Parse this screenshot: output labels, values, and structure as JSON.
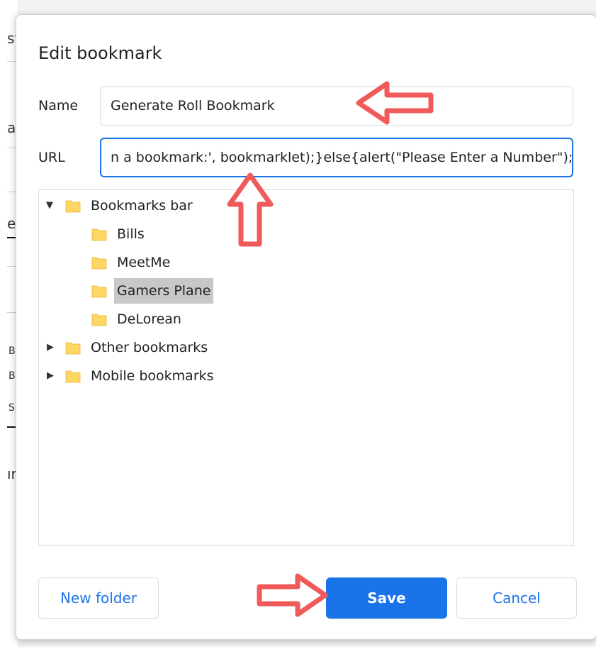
{
  "background": {
    "fragments": [
      "st",
      "a",
      "e",
      "B",
      "B",
      "S",
      "ır"
    ]
  },
  "dialog": {
    "title": "Edit bookmark",
    "name_label": "Name",
    "name_value": "Generate Roll Bookmark",
    "url_label": "URL",
    "url_value": "n a bookmark:', bookmarklet);}else{alert(\"Please Enter a Number\");}",
    "tree": {
      "items": [
        {
          "label": "Bookmarks bar",
          "expanded": true,
          "icon": "folder-icon"
        },
        {
          "label": "Bills",
          "icon": "folder-icon"
        },
        {
          "label": "MeetMe",
          "icon": "folder-icon"
        },
        {
          "label": "Gamers Plane",
          "selected": true,
          "icon": "folder-icon"
        },
        {
          "label": "DeLorean",
          "icon": "folder-icon"
        },
        {
          "label": "Other bookmarks",
          "expanded": false,
          "icon": "folder-icon"
        },
        {
          "label": "Mobile bookmarks",
          "expanded": false,
          "icon": "folder-icon"
        }
      ]
    },
    "buttons": {
      "new_folder": "New folder",
      "save": "Save",
      "cancel": "Cancel"
    }
  },
  "colors": {
    "accent": "#1a73e8",
    "folder": "#fdd663",
    "annotation_arrow": "#f05a5a",
    "selection": "#c8c8c8"
  }
}
